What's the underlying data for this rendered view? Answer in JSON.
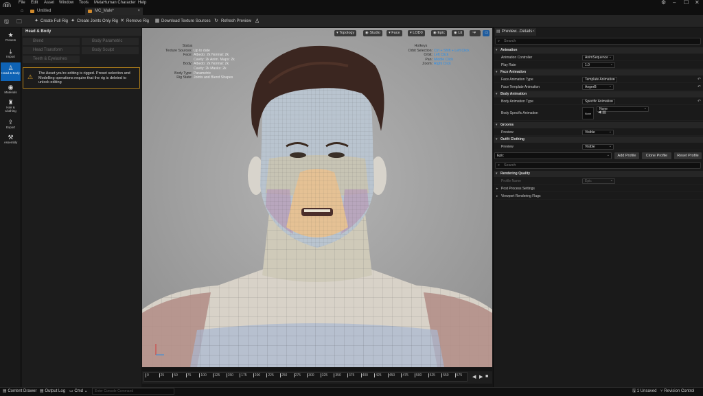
{
  "menu": [
    "File",
    "Edit",
    "Asset",
    "Window",
    "Tools",
    "MetaHuman Character",
    "Help"
  ],
  "tabs": [
    {
      "label": "Untitled"
    },
    {
      "label": "MC_Male*"
    }
  ],
  "toolbar": {
    "create_full_rig": "Create Full Rig",
    "create_joints_only_rig": "Create Joints Only Rig",
    "remove_rig": "Remove Rig",
    "download_texture_sources": "Download Texture Sources",
    "refresh_preview": "Refresh Preview"
  },
  "left_tools": [
    {
      "label": "Presets",
      "icon": "star-icon"
    },
    {
      "label": "Import",
      "icon": "import-icon"
    },
    {
      "label": "Head & Body",
      "icon": "person-icon"
    },
    {
      "label": "Materials",
      "icon": "materials-icon"
    },
    {
      "label": "Hair & Clothing",
      "icon": "hair-icon"
    },
    {
      "label": "Export",
      "icon": "export-icon"
    },
    {
      "label": "Assembly",
      "icon": "hammer-icon"
    }
  ],
  "left_panel": {
    "title": "Head & Body",
    "buttons": [
      "Blend",
      "Body Parametric",
      "Head Transform",
      "Body Sculpt",
      "Teeth & Eyelashes"
    ],
    "warning": "The Asset you're editing is rigged. Preset selection and Modelling operations require that the rig is deleted to unlock editing"
  },
  "viewport": {
    "controls": [
      "Topology",
      "Studio",
      "Face",
      "LOD0",
      "Epic",
      "Lit"
    ],
    "status_title": "Status",
    "status": [
      {
        "k": "Texture Sources:",
        "v": "Up to date"
      },
      {
        "k": "Face:",
        "v": "Albedo: 2k Normal: 2k"
      },
      {
        "k": "",
        "v": "Cavity: 2k Anim. Maps: 2k"
      },
      {
        "k": "Body:",
        "v": "Albedo: 2k Normal: 2k"
      },
      {
        "k": "",
        "v": "Cavity: 2k Masks: 2k"
      },
      {
        "k": "Body Type:",
        "v": "Parametric"
      },
      {
        "k": "Rig State:",
        "v": "Joints and Blend Shapes"
      }
    ],
    "hotkeys_title": "Hotkeys",
    "hotkeys": [
      {
        "k": "Orbit Selection:",
        "v": "Ctrl + Shift + Left Click"
      },
      {
        "k": "Orbit:",
        "v": "Left Click"
      },
      {
        "k": "Pan:",
        "v": "Middle Click"
      },
      {
        "k": "Zoom:",
        "v": "Right Click"
      }
    ]
  },
  "timeline": {
    "ticks": [
      "0",
      "25",
      "50",
      "75",
      "100",
      "125",
      "150",
      "175",
      "200",
      "225",
      "250",
      "275",
      "300",
      "325",
      "350",
      "375",
      "400",
      "425",
      "450",
      "475",
      "500",
      "525",
      "550",
      "575"
    ]
  },
  "details": {
    "tab_label": "Preview...Details",
    "search_placeholder": "Search",
    "sections": {
      "animation": "Animation",
      "face_animation": "Face Animation",
      "body_animation": "Body Animation",
      "grooms": "Grooms",
      "outfit_clothing": "Outfit Clothing",
      "rendering_quality": "Rendering Quality"
    },
    "rows": {
      "animation_controller": {
        "label": "Animation Controller",
        "value": "AnimSequence"
      },
      "play_rate": {
        "label": "Play Rate",
        "value": "1.0"
      },
      "face_animation_type": {
        "label": "Face Animation Type",
        "value": "Template Animation"
      },
      "face_template_animation": {
        "label": "Face Template Animation",
        "value": "AngerB"
      },
      "body_animation_type": {
        "label": "Body Animation Type",
        "value": "Specific Animation"
      },
      "body_specific_animation": {
        "label": "Body Specific Animation",
        "value": "None",
        "thumb": "None"
      },
      "grooms_preview": {
        "label": "Preview",
        "value": "Visible"
      },
      "outfit_preview": {
        "label": "Preview",
        "value": "Visible"
      },
      "profile_name": {
        "label": "Profile Name",
        "value": "Epic"
      },
      "post_process": {
        "label": "Post Process Settings"
      },
      "viewport_flags": {
        "label": "Viewport Rendering Flags"
      }
    },
    "profile_select": "Epic",
    "add_profile": "Add Profile",
    "clone_profile": "Clone Profile",
    "reset_profile": "Reset Profile",
    "search2_placeholder": "Search"
  },
  "statusbar": {
    "content_drawer": "Content Drawer",
    "output_log": "Output Log",
    "cmd": "Cmd",
    "console_placeholder": "Enter Console Command",
    "unsaved": "1 Unsaved",
    "revision_control": "Revision Control"
  }
}
